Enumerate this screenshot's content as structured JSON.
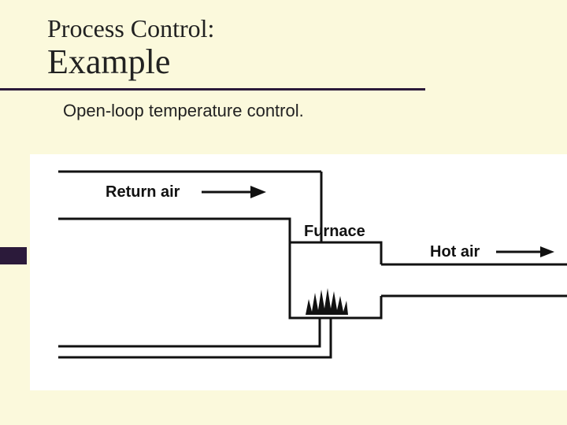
{
  "header": {
    "kicker": "Process Control:",
    "title": "Example",
    "subtitle": "Open-loop temperature control."
  },
  "diagram": {
    "labels": {
      "return_air": "Return air",
      "furnace": "Furnace",
      "hot_air": "Hot air"
    },
    "elements": {
      "return_duct": "return-air-duct",
      "furnace_box": "furnace",
      "hot_duct": "hot-air-duct",
      "fuel_line": "fuel-line",
      "flame": "flame"
    }
  }
}
